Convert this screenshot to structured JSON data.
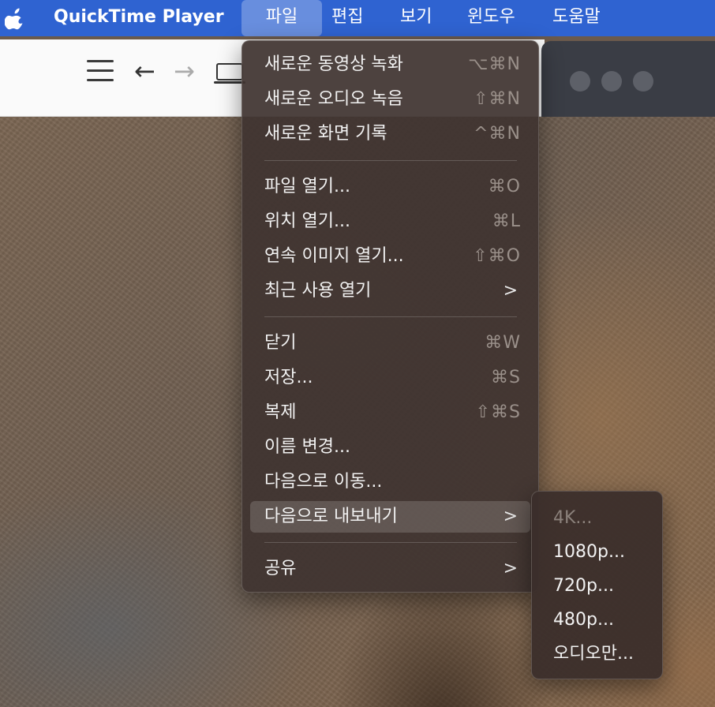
{
  "menubar": {
    "app_name": "QuickTime Player",
    "items": [
      "파일",
      "편집",
      "보기",
      "윈도우",
      "도움말"
    ]
  },
  "toolbar": {
    "back_icon": "←",
    "forward_icon": "→"
  },
  "file_menu": {
    "items": [
      {
        "label": "새로운 동영상 녹화",
        "shortcut": "⌥⌘N"
      },
      {
        "label": "새로운 오디오 녹음",
        "shortcut": "⇧⌘N"
      },
      {
        "label": "새로운 화면 기록",
        "shortcut": "^⌘N"
      },
      {
        "label": "파일 열기...",
        "shortcut": "⌘O"
      },
      {
        "label": "위치 열기...",
        "shortcut": "⌘L"
      },
      {
        "label": "연속 이미지 열기...",
        "shortcut": "⇧⌘O"
      },
      {
        "label": "최근 사용 열기",
        "shortcut": "",
        "submenu": true
      },
      {
        "label": "닫기",
        "shortcut": "⌘W"
      },
      {
        "label": "저장...",
        "shortcut": "⌘S"
      },
      {
        "label": "복제",
        "shortcut": "⇧⌘S"
      },
      {
        "label": "이름 변경...",
        "shortcut": ""
      },
      {
        "label": "다음으로 이동...",
        "shortcut": ""
      },
      {
        "label": "다음으로 내보내기",
        "shortcut": "",
        "submenu": true,
        "highlighted": true
      },
      {
        "label": "공유",
        "shortcut": "",
        "submenu": true
      }
    ],
    "chevron": ">"
  },
  "export_submenu": {
    "items": [
      {
        "label": "4K...",
        "enabled": false
      },
      {
        "label": "1080p...",
        "enabled": true
      },
      {
        "label": "720p...",
        "enabled": true
      },
      {
        "label": "480p...",
        "enabled": true
      },
      {
        "label": "오디오만...",
        "enabled": true
      }
    ]
  },
  "colors": {
    "menubar_bg": "#2f63d1",
    "menu_bg": "#403430",
    "highlight": "#5a4e4a"
  }
}
